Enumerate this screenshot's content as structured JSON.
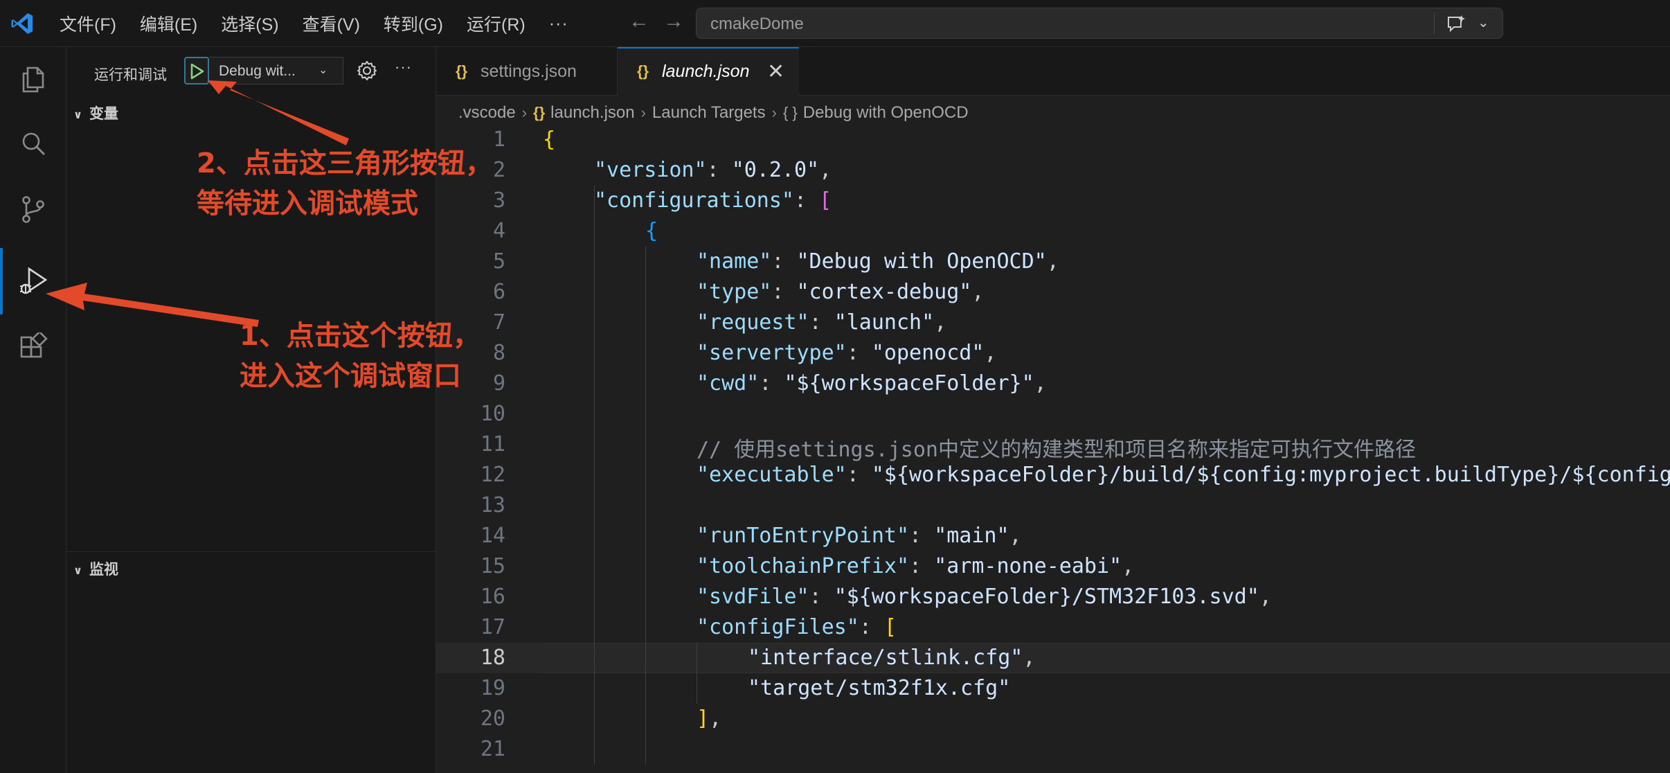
{
  "titlebar": {
    "menus": [
      "文件(F)",
      "编辑(E)",
      "选择(S)",
      "查看(V)",
      "转到(G)",
      "运行(R)"
    ],
    "more": "···",
    "search_text": "cmakeDome"
  },
  "activity": {
    "items": [
      "explorer-icon",
      "search-icon",
      "source-control-icon",
      "run-debug-icon",
      "extensions-icon"
    ],
    "active": "run-debug-icon"
  },
  "sidebar": {
    "title": "运行和调试",
    "config_label": "Debug wit...",
    "more": "···",
    "sections": [
      {
        "label": "变量",
        "expanded": true
      },
      {
        "label": "监视",
        "expanded": true
      }
    ]
  },
  "tabs": [
    {
      "icon": "{}",
      "label": "settings.json",
      "active": false
    },
    {
      "icon": "{}",
      "label": "launch.json",
      "active": true,
      "close": "✕"
    }
  ],
  "breadcrumb": {
    "items": [
      ".vscode",
      "launch.json",
      "Launch Targets",
      "Debug with OpenOCD"
    ],
    "json_icon": "{}",
    "obj_icon": "{ }",
    "sep": "›"
  },
  "editor": {
    "current_line": 18,
    "lines": [
      {
        "n": "1",
        "ind": 0,
        "t": [
          [
            "b1",
            "{"
          ]
        ]
      },
      {
        "n": "2",
        "ind": 1,
        "t": [
          [
            "k",
            "\"version\""
          ],
          [
            "p",
            ": "
          ],
          [
            "s2",
            "\"0.2.0\""
          ],
          [
            "p",
            ","
          ]
        ]
      },
      {
        "n": "3",
        "ind": 1,
        "t": [
          [
            "k",
            "\"configurations\""
          ],
          [
            "p",
            ": "
          ],
          [
            "b2",
            "["
          ]
        ]
      },
      {
        "n": "4",
        "ind": 2,
        "t": [
          [
            "b3",
            "{"
          ]
        ]
      },
      {
        "n": "5",
        "ind": 3,
        "t": [
          [
            "k",
            "\"name\""
          ],
          [
            "p",
            ": "
          ],
          [
            "s2",
            "\"Debug with OpenOCD\""
          ],
          [
            "p",
            ","
          ]
        ]
      },
      {
        "n": "6",
        "ind": 3,
        "t": [
          [
            "k",
            "\"type\""
          ],
          [
            "p",
            ": "
          ],
          [
            "s2",
            "\"cortex-debug\""
          ],
          [
            "p",
            ","
          ]
        ]
      },
      {
        "n": "7",
        "ind": 3,
        "t": [
          [
            "k",
            "\"request\""
          ],
          [
            "p",
            ": "
          ],
          [
            "s2",
            "\"launch\""
          ],
          [
            "p",
            ","
          ]
        ]
      },
      {
        "n": "8",
        "ind": 3,
        "t": [
          [
            "k",
            "\"servertype\""
          ],
          [
            "p",
            ": "
          ],
          [
            "s2",
            "\"openocd\""
          ],
          [
            "p",
            ","
          ]
        ]
      },
      {
        "n": "9",
        "ind": 3,
        "t": [
          [
            "k",
            "\"cwd\""
          ],
          [
            "p",
            ": "
          ],
          [
            "s2",
            "\"${workspaceFolder}\""
          ],
          [
            "p",
            ","
          ]
        ]
      },
      {
        "n": "10",
        "ind": 3,
        "t": []
      },
      {
        "n": "11",
        "ind": 3,
        "t": [
          [
            "c",
            "// 使用settings.json中定义的构建类型和项目名称来指定可执行文件路径"
          ]
        ]
      },
      {
        "n": "12",
        "ind": 3,
        "t": [
          [
            "k",
            "\"executable\""
          ],
          [
            "p",
            ": "
          ],
          [
            "s2",
            "\"${workspaceFolder}/build/${config:myproject.buildType}/${config:myproject.projectName}.elf\""
          ]
        ]
      },
      {
        "n": "13",
        "ind": 3,
        "t": []
      },
      {
        "n": "14",
        "ind": 3,
        "t": [
          [
            "k",
            "\"runToEntryPoint\""
          ],
          [
            "p",
            ": "
          ],
          [
            "s2",
            "\"main\""
          ],
          [
            "p",
            ","
          ]
        ]
      },
      {
        "n": "15",
        "ind": 3,
        "t": [
          [
            "k",
            "\"toolchainPrefix\""
          ],
          [
            "p",
            ": "
          ],
          [
            "s2",
            "\"arm-none-eabi\""
          ],
          [
            "p",
            ","
          ]
        ]
      },
      {
        "n": "16",
        "ind": 3,
        "t": [
          [
            "k",
            "\"svdFile\""
          ],
          [
            "p",
            ": "
          ],
          [
            "s2",
            "\"${workspaceFolder}/STM32F103.svd\""
          ],
          [
            "p",
            ","
          ]
        ]
      },
      {
        "n": "17",
        "ind": 3,
        "t": [
          [
            "k",
            "\"configFiles\""
          ],
          [
            "p",
            ": "
          ],
          [
            "b1",
            "["
          ]
        ]
      },
      {
        "n": "18",
        "ind": 4,
        "t": [
          [
            "s2",
            "\"interface/stlink.cfg\""
          ],
          [
            "p",
            ","
          ]
        ]
      },
      {
        "n": "19",
        "ind": 4,
        "t": [
          [
            "s2",
            "\"target/stm32f1x.cfg\""
          ]
        ]
      },
      {
        "n": "20",
        "ind": 3,
        "t": [
          [
            "b1",
            "]"
          ],
          [
            "p",
            ","
          ]
        ]
      },
      {
        "n": "21",
        "ind": 3,
        "t": []
      }
    ]
  },
  "annotations": {
    "step2_line1": "2、点击这三角形按钮，",
    "step2_line2": "等待进入调试模式",
    "step1_line1": "1、点击这个按钮，",
    "step1_line2": "进入这个调试窗口",
    "color": "#e24a2a"
  },
  "colors": {
    "accent": "#0078d4",
    "background": "#1f1f1f",
    "chrome": "#181818"
  }
}
